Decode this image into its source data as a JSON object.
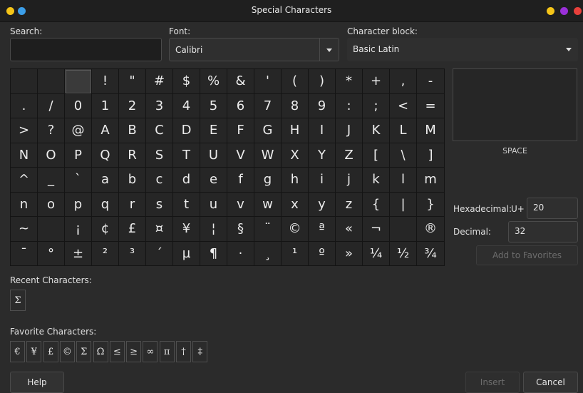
{
  "window": {
    "title": "Special Characters",
    "left_dots": [
      "#f5c518",
      "#3b9ee8"
    ],
    "right_dots": [
      "#f5c518",
      "#9b30d9",
      "#e8403b"
    ]
  },
  "search": {
    "label": "Search:",
    "value": ""
  },
  "font": {
    "label": "Font:",
    "value": "Calibri"
  },
  "block": {
    "label": "Character block:",
    "value": "Basic Latin"
  },
  "grid_rows": [
    [
      "",
      "",
      "",
      "!",
      "\"",
      "#",
      "$",
      "%",
      "&",
      "'",
      "(",
      ")",
      "*",
      "+",
      ",",
      "-"
    ],
    [
      ".",
      "/",
      "0",
      "1",
      "2",
      "3",
      "4",
      "5",
      "6",
      "7",
      "8",
      "9",
      ":",
      ";",
      "<",
      "="
    ],
    [
      ">",
      "?",
      "@",
      "A",
      "B",
      "C",
      "D",
      "E",
      "F",
      "G",
      "H",
      "I",
      "J",
      "K",
      "L",
      "M"
    ],
    [
      "N",
      "O",
      "P",
      "Q",
      "R",
      "S",
      "T",
      "U",
      "V",
      "W",
      "X",
      "Y",
      "Z",
      "[",
      "\\",
      "]"
    ],
    [
      "^",
      "_",
      "`",
      "a",
      "b",
      "c",
      "d",
      "e",
      "f",
      "g",
      "h",
      "i",
      "j",
      "k",
      "l",
      "m"
    ],
    [
      "n",
      "o",
      "p",
      "q",
      "r",
      "s",
      "t",
      "u",
      "v",
      "w",
      "x",
      "y",
      "z",
      "{",
      "|",
      "}"
    ],
    [
      "~",
      "",
      "¡",
      "¢",
      "£",
      "¤",
      "¥",
      "¦",
      "§",
      "¨",
      "©",
      "ª",
      "«",
      "¬",
      "",
      "®"
    ],
    [
      "¯",
      "°",
      "±",
      "²",
      "³",
      "´",
      "µ",
      "¶",
      "·",
      "¸",
      "¹",
      "º",
      "»",
      "¼",
      "½",
      "¾"
    ]
  ],
  "selected_name": "SPACE",
  "hex": {
    "label": "Hexadecimal:",
    "prefix": "U+",
    "value": "20"
  },
  "dec": {
    "label": "Decimal:",
    "value": "32"
  },
  "add_favorites": "Add to Favorites",
  "recent": {
    "label": "Recent Characters:",
    "items": [
      "Σ"
    ]
  },
  "favorites": {
    "label": "Favorite Characters:",
    "items": [
      "€",
      "¥",
      "£",
      "©",
      "Σ",
      "Ω",
      "≤",
      "≥",
      "∞",
      "π",
      "†",
      "‡"
    ]
  },
  "buttons": {
    "help": "Help",
    "insert": "Insert",
    "cancel": "Cancel"
  }
}
